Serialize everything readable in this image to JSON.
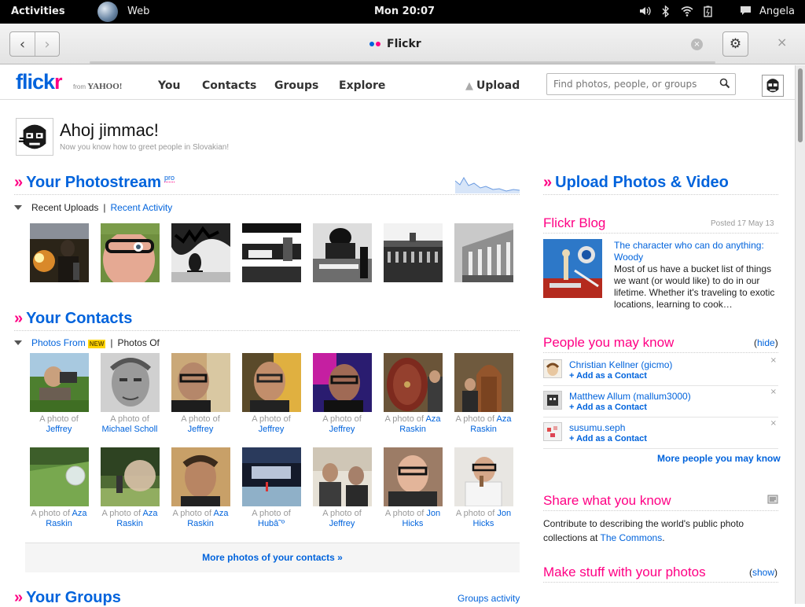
{
  "system": {
    "activities": "Activities",
    "app_name": "Web",
    "clock": "Mon 20:07",
    "user": "Angela",
    "icons": [
      "volume-icon",
      "bluetooth-icon",
      "wifi-icon",
      "battery-icon",
      "chat-icon"
    ]
  },
  "browser": {
    "tab_title": "Flickr",
    "back": "‹",
    "forward": "›",
    "gear": "⚙",
    "close": "×",
    "clear": "×"
  },
  "flickr_header": {
    "logo_fl": "flick",
    "logo_kr": "r",
    "logo_from": "from",
    "logo_yahoo": "YAHOO!",
    "nav": [
      "You",
      "Contacts",
      "Groups",
      "Explore"
    ],
    "upload": "Upload",
    "search_placeholder": "Find photos, people, or groups"
  },
  "greeting": {
    "title": "Ahoj jimmac!",
    "subtitle": "Now you know how to greet people in Slovakian!"
  },
  "photostream": {
    "heading": "Your Photostream",
    "pro": "pro",
    "tab_recent": "Recent Uploads",
    "tab_sep": "|",
    "tab_activity": "Recent Activity"
  },
  "contacts": {
    "heading": "Your Contacts",
    "tab_from": "Photos From",
    "new_badge": "NEW",
    "tab_sep": "|",
    "tab_of": "Photos Of",
    "prefix": "A photo of",
    "row1": [
      "Jeffrey",
      "Michael Scholl",
      "Jeffrey",
      "Jeffrey",
      "Jeffrey",
      "Aza Raskin",
      "Aza Raskin"
    ],
    "row2": [
      "Aza Raskin",
      "Aza Raskin",
      "Aza Raskin",
      "Hubâ˜º",
      "Jeffrey",
      "Jon Hicks",
      "Jon Hicks"
    ],
    "more": "More photos of your contacts »"
  },
  "groups": {
    "heading": "Your Groups",
    "activity": "Groups activity"
  },
  "sidebar": {
    "upload_heading": "Upload Photos & Video",
    "blog_heading": "Flickr Blog",
    "blog_date": "Posted 17 May 13",
    "blog_title": "The character who can do anything: Woody",
    "blog_text": "Most of us have a bucket list of things we want (or would like) to do in our lifetime. Whether it's traveling to exotic locations, learning to cook…",
    "pymk_heading": "People you may know",
    "hide_open": "(",
    "hide": "hide",
    "hide_close": ")",
    "people": [
      {
        "name": "Christian Kellner (gicmo)",
        "action": "+ Add as a Contact"
      },
      {
        "name": "Matthew Allum (mallum3000)",
        "action": "+ Add as a Contact"
      },
      {
        "name": "susumu.seph",
        "action": "+ Add as a Contact"
      }
    ],
    "pymk_more": "More people you may know",
    "share_heading": "Share what you know",
    "share_text": "Contribute to describing the world's public photo collections at",
    "share_link": "The Commons",
    "share_dot": ".",
    "make_heading": "Make stuff with your photos",
    "show_open": "(",
    "show": "show",
    "show_close": ")"
  },
  "colors": {
    "flickr_blue": "#0063dc",
    "flickr_pink": "#ff0084"
  }
}
